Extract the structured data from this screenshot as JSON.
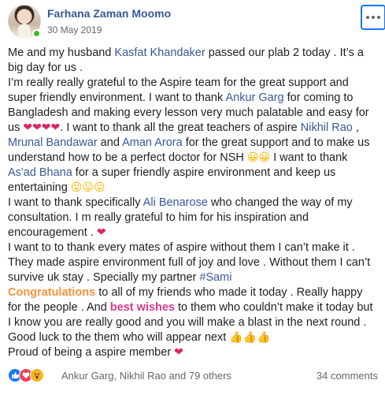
{
  "author": {
    "name": "Farhana Zaman Moomo",
    "date": "30 May 2019"
  },
  "colors": {
    "link": "#385898",
    "online": "#42b72a",
    "congrats": "#f7923b",
    "wishes": "#d73b8e",
    "heart": "#e0245e"
  },
  "icons": {
    "more": "more-options-icon",
    "like": "like-reaction-icon",
    "love": "love-reaction-icon",
    "wow": "wow-reaction-icon"
  },
  "post": {
    "l1a": "Me and my husband ",
    "l1m": "Kasfat Khandaker",
    "l1b": " passed our plab 2 today . It’s a big day for us .",
    "p2a": "I’m really really grateful to the Aspire team for the great support and super friendly environment. I want to thank ",
    "p2m1": "Ankur Garg",
    "p2b": " for coming to Bangladesh and making every lesson very much palatable and easy for us ",
    "p2e1": "❤❤❤❤",
    "p2c": ". I want to thank all the great teachers of aspire ",
    "p2m2": "Nikhil Rao",
    "p2d": " , ",
    "p2m3": "Mrunal Bandawar",
    "p2e": " and ",
    "p2m4": "Aman Arora",
    "p2f": " for the great support and to make us understand how to be a perfect doctor for NSH ",
    "p2e2": "😀😀",
    "p2g": " I want to thank ",
    "p2m5": "As'ad Bhana",
    "p2h": " for a super friendly aspire environment and keep us entertaining ",
    "p2e3": "😛😛😛",
    "p3a": "I want to thank specifically ",
    "p3m": "Ali Benarose",
    "p3b": " who changed the way of my consultation. I m really grateful to him for his inspiration and encouragement . ",
    "p3e": "❤",
    "p4a": "I want to to thank every mates of aspire without them I can’t make it . They made aspire environment full of joy and love . Without them I can’t survive uk stay . Specially my partner ",
    "p4h": "#Sami",
    "p5a": "Congratulations",
    "p5b": " to all of my friends who made it today . Really happy for the people . And ",
    "p5c": "best wishes",
    "p5d": " to them who couldn’t make it today but I know you are really good and you will make a blast in the next round . Good luck to the them who will appear next ",
    "p5e": "👍👍👍",
    "p6a": "Proud of being a aspire member ",
    "p6e": "❤"
  },
  "footer": {
    "reactors": "Ankur Garg, Nikhil Rao and 79 others",
    "comments": "34 comments"
  }
}
